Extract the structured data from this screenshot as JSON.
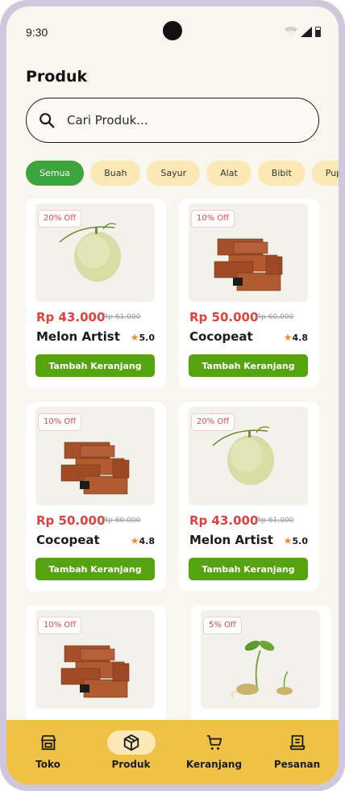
{
  "status_bar": {
    "time": "9:30"
  },
  "page": {
    "title": "Produk"
  },
  "search": {
    "placeholder": "Cari Produk..."
  },
  "categories": [
    {
      "label": "Semua",
      "active": true
    },
    {
      "label": "Buah",
      "active": false
    },
    {
      "label": "Sayur",
      "active": false
    },
    {
      "label": "Alat",
      "active": false
    },
    {
      "label": "Bibit",
      "active": false
    },
    {
      "label": "Pupuk",
      "active": false
    }
  ],
  "products": [
    {
      "discount": "20% Off",
      "price": "Rp 43.000",
      "old_price": "Rp 61.000",
      "name": "Melon Artist",
      "rating": "5.0",
      "button": "Tambah Keranjang",
      "image": "melon"
    },
    {
      "discount": "10% Off",
      "price": "Rp 50.000",
      "old_price": "Rp 60.000",
      "name": "Cocopeat",
      "rating": "4.8",
      "button": "Tambah Keranjang",
      "image": "cocopeat"
    },
    {
      "discount": "10% Off",
      "price": "Rp 50.000",
      "old_price": "Rp 60.000",
      "name": "Cocopeat",
      "rating": "4.8",
      "button": "Tambah Keranjang",
      "image": "cocopeat"
    },
    {
      "discount": "20% Off",
      "price": "Rp 43.000",
      "old_price": "Rp 61.000",
      "name": "Melon Artist",
      "rating": "5.0",
      "button": "Tambah Keranjang",
      "image": "melon"
    },
    {
      "discount": "10% Off",
      "price": "",
      "old_price": "",
      "name": "",
      "rating": "",
      "button": "",
      "image": "cocopeat"
    },
    {
      "discount": "5% Off",
      "price": "",
      "old_price": "",
      "name": "",
      "rating": "",
      "button": "",
      "image": "sprout"
    }
  ],
  "bottom_nav": [
    {
      "label": "Toko",
      "icon": "store-icon",
      "active": false
    },
    {
      "label": "Produk",
      "icon": "box-icon",
      "active": true
    },
    {
      "label": "Keranjang",
      "icon": "cart-icon",
      "active": false
    },
    {
      "label": "Pesanan",
      "icon": "receipt-icon",
      "active": false
    }
  ],
  "colors": {
    "accent_green": "#55a30e",
    "chip_active": "#3da53d",
    "price_red": "#e0413f",
    "nav_yellow": "#efc246",
    "chip_bg": "#fbe8b4"
  }
}
